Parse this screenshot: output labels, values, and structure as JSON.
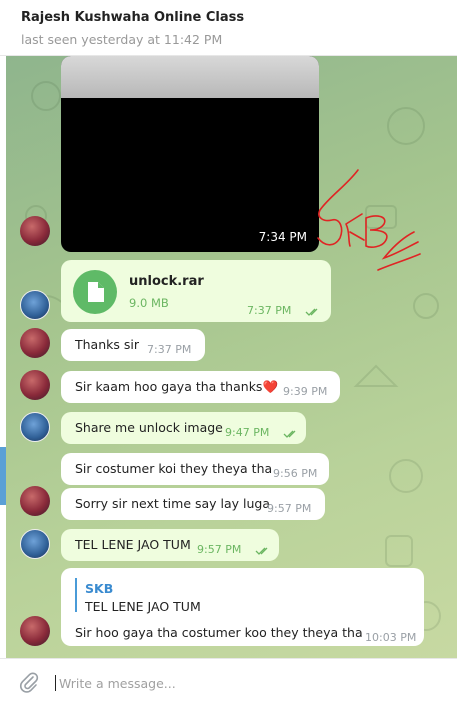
{
  "header": {
    "title": "Rajesh Kushwaha Online Class",
    "status": "last seen yesterday at 11:42 PM"
  },
  "messages": [
    {
      "id": "m-media",
      "kind": "media",
      "time": "7:34 PM",
      "annotation": "SKB"
    },
    {
      "id": "m-file",
      "kind": "file",
      "file_name": "unlock.rar",
      "file_size": "9.0 MB",
      "time": "7:37 PM",
      "read": true
    },
    {
      "id": "m1",
      "text": "Thanks sir",
      "time": "7:37 PM"
    },
    {
      "id": "m2",
      "text": "Sir kaam hoo gaya tha thanks❤️",
      "time": "9:39 PM"
    },
    {
      "id": "m3",
      "text": "Share me unlock image",
      "time": "9:47 PM",
      "read": true
    },
    {
      "id": "m4",
      "text": "Sir costumer koi they theya tha",
      "time": "9:56 PM"
    },
    {
      "id": "m5",
      "text": "Sorry sir next time say lay luga",
      "time": "9:57 PM"
    },
    {
      "id": "m6",
      "text": "TEL LENE JAO TUM",
      "time": "9:57 PM",
      "read": true
    },
    {
      "id": "m7",
      "reply_name": "SKB",
      "reply_text": "TEL LENE JAO TUM",
      "text": "Sir hoo gaya tha costumer koo they theya tha",
      "time": "10:03 PM"
    }
  ],
  "composer": {
    "placeholder": "Write a message..."
  },
  "colors": {
    "incoming_bg": "#ffffff",
    "outgoing_bg": "#effdde",
    "outgoing_time": "#6cb662",
    "file_icon": "#5fba67",
    "reply_name": "#3a8bd0",
    "annotation_ink": "#e02424"
  }
}
